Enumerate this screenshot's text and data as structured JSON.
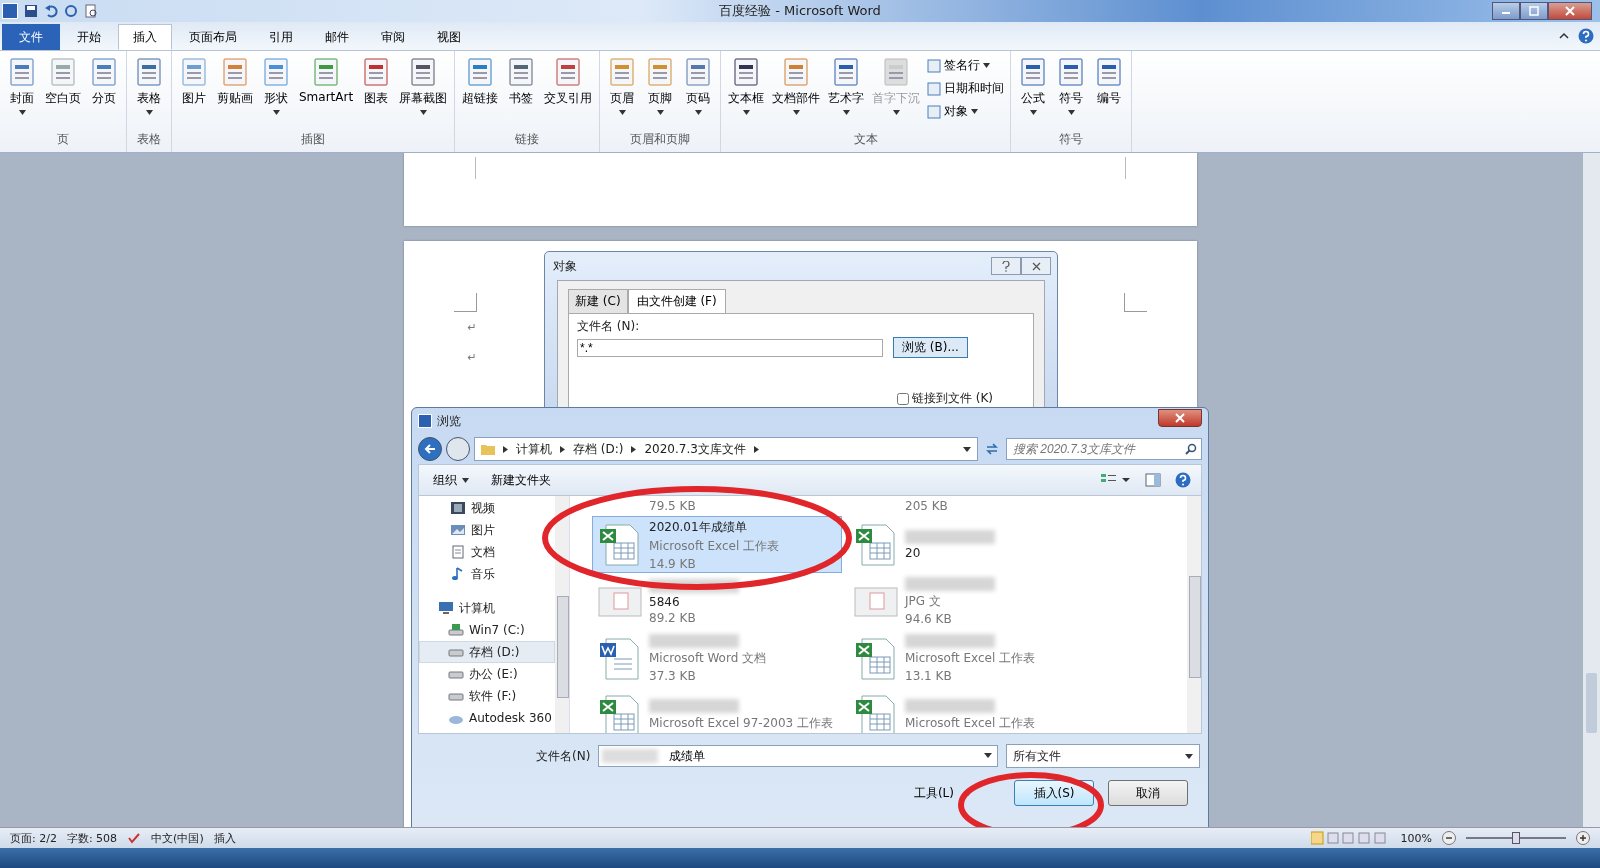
{
  "window": {
    "title": "百度经验 - Microsoft Word"
  },
  "ribbon_tabs": [
    {
      "label": "文件",
      "kind": "file",
      "selected": false
    },
    {
      "label": "开始",
      "kind": "tab",
      "selected": false
    },
    {
      "label": "插入",
      "kind": "tab",
      "selected": true
    },
    {
      "label": "页面布局",
      "kind": "tab",
      "selected": false
    },
    {
      "label": "引用",
      "kind": "tab",
      "selected": false
    },
    {
      "label": "邮件",
      "kind": "tab",
      "selected": false
    },
    {
      "label": "审阅",
      "kind": "tab",
      "selected": false
    },
    {
      "label": "视图",
      "kind": "tab",
      "selected": false
    }
  ],
  "ribbon_groups": [
    {
      "label": "页",
      "buttons": [
        {
          "label": "封面",
          "dropdown": true,
          "disabled": false
        },
        {
          "label": "空白页",
          "dropdown": false,
          "disabled": false
        },
        {
          "label": "分页",
          "dropdown": false,
          "disabled": false
        }
      ]
    },
    {
      "label": "表格",
      "buttons": [
        {
          "label": "表格",
          "dropdown": true,
          "disabled": false
        }
      ]
    },
    {
      "label": "插图",
      "buttons": [
        {
          "label": "图片",
          "dropdown": false,
          "disabled": false
        },
        {
          "label": "剪贴画",
          "dropdown": false,
          "disabled": false
        },
        {
          "label": "形状",
          "dropdown": true,
          "disabled": false
        },
        {
          "label": "SmartArt",
          "dropdown": false,
          "disabled": false
        },
        {
          "label": "图表",
          "dropdown": false,
          "disabled": false
        },
        {
          "label": "屏幕截图",
          "dropdown": true,
          "disabled": false
        }
      ]
    },
    {
      "label": "链接",
      "buttons": [
        {
          "label": "超链接",
          "dropdown": false,
          "disabled": false
        },
        {
          "label": "书签",
          "dropdown": false,
          "disabled": false
        },
        {
          "label": "交叉引用",
          "dropdown": false,
          "disabled": false
        }
      ]
    },
    {
      "label": "页眉和页脚",
      "buttons": [
        {
          "label": "页眉",
          "dropdown": true,
          "disabled": false
        },
        {
          "label": "页脚",
          "dropdown": true,
          "disabled": false
        },
        {
          "label": "页码",
          "dropdown": true,
          "disabled": false
        }
      ]
    },
    {
      "label": "文本",
      "buttons": [
        {
          "label": "文本框",
          "dropdown": true,
          "disabled": false
        },
        {
          "label": "文档部件",
          "dropdown": true,
          "disabled": false
        },
        {
          "label": "艺术字",
          "dropdown": true,
          "disabled": false
        },
        {
          "label": "首字下沉",
          "dropdown": true,
          "disabled": true
        }
      ],
      "small_buttons": [
        {
          "label": "签名行",
          "dropdown": true
        },
        {
          "label": "日期和时间",
          "dropdown": false
        },
        {
          "label": "对象",
          "dropdown": true
        }
      ]
    },
    {
      "label": "符号",
      "buttons": [
        {
          "label": "公式",
          "dropdown": true,
          "disabled": false
        },
        {
          "label": "符号",
          "dropdown": true,
          "disabled": false
        },
        {
          "label": "编号",
          "dropdown": false,
          "disabled": false
        }
      ]
    }
  ],
  "document": {
    "paragraph_marks": [
      "↵",
      "↵"
    ]
  },
  "object_dialog": {
    "title": "对象",
    "tabs": [
      {
        "label": "新建 (C)",
        "selected": false
      },
      {
        "label": "由文件创建 (F)",
        "selected": true
      }
    ],
    "file_label": "文件名 (N):",
    "file_value": "*.*",
    "browse_button": "浏览 (B)...",
    "link_checkbox": {
      "label": "链接到文件 (K)",
      "checked": false
    }
  },
  "browse_dialog": {
    "title": "浏览",
    "breadcrumbs": [
      "计算机",
      "存档 (D:)",
      "2020.7.3文库文件"
    ],
    "search": {
      "placeholder": "搜索 2020.7.3文库文件"
    },
    "toolbar": {
      "organize": "组织",
      "new_folder": "新建文件夹"
    },
    "nav_items": [
      {
        "label": "视频",
        "kind": "video",
        "selected": false
      },
      {
        "label": "图片",
        "kind": "pictures",
        "selected": false
      },
      {
        "label": "文档",
        "kind": "documents",
        "selected": false
      },
      {
        "label": "音乐",
        "kind": "music",
        "selected": false
      },
      {
        "label": "计算机",
        "kind": "computer",
        "selected": false,
        "children": [
          {
            "label": "Win7 (C:)",
            "kind": "system-drive",
            "selected": false
          },
          {
            "label": "存档 (D:)",
            "kind": "drive",
            "selected": true
          },
          {
            "label": "办公 (E:)",
            "kind": "drive",
            "selected": false
          },
          {
            "label": "软件 (F:)",
            "kind": "drive",
            "selected": false
          },
          {
            "label": "Autodesk 360",
            "kind": "cloud",
            "selected": false
          }
        ]
      }
    ],
    "files": [
      {
        "kind": "none",
        "size": "79.5 KB",
        "selected": false,
        "blurred": false
      },
      {
        "kind": "none",
        "size": "205 KB",
        "selected": false,
        "blurred": false
      },
      {
        "kind": "excel",
        "name": "2020.01年成绩单",
        "type": "Microsoft Excel 工作表",
        "size": "14.9 KB",
        "selected": true,
        "blurred": false
      },
      {
        "kind": "excel",
        "name": "20",
        "selected": false,
        "blurred": true
      },
      {
        "kind": "image",
        "name": "5846",
        "size": "89.2 KB",
        "selected": false,
        "blurred": true
      },
      {
        "kind": "image",
        "type": "JPG 文",
        "size": "94.6 KB",
        "selected": false,
        "blurred": true
      },
      {
        "kind": "word",
        "type": "Microsoft Word 文档",
        "size": "37.3 KB",
        "selected": false,
        "blurred": true
      },
      {
        "kind": "excel",
        "type": "Microsoft Excel 工作表",
        "size": "13.1 KB",
        "selected": false,
        "blurred": true
      },
      {
        "kind": "excel",
        "type": "Microsoft Excel 97-2003 工作表",
        "selected": false,
        "blurred": true
      },
      {
        "kind": "excel",
        "type": "Microsoft Excel 工作表",
        "selected": false,
        "blurred": true
      }
    ],
    "filename_label": "文件名(N)",
    "filename_value": "成绩单",
    "filter": "所有文件",
    "tools": "工具(L)",
    "insert_button": "插入(S)",
    "cancel_button": "取消"
  },
  "status_bar": {
    "items": [
      "页面: 2/2",
      "字数: 508",
      "中文(中国)",
      "插入"
    ],
    "zoom": "100%",
    "zoom_slider": {
      "level": 0.5
    }
  }
}
